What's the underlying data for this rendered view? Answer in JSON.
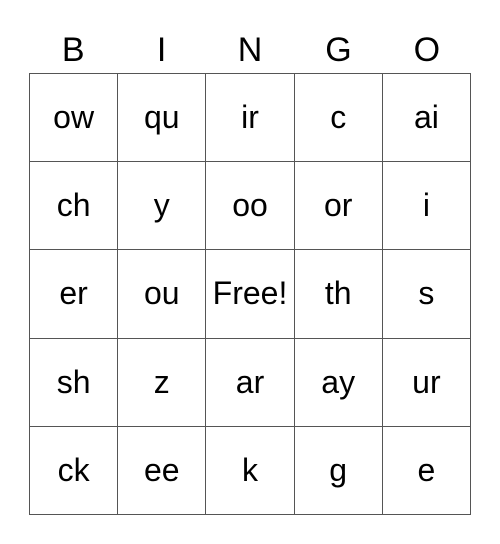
{
  "header": [
    "B",
    "I",
    "N",
    "G",
    "O"
  ],
  "board": [
    [
      "ow",
      "qu",
      "ir",
      "c",
      "ai"
    ],
    [
      "ch",
      "y",
      "oo",
      "or",
      "i"
    ],
    [
      "er",
      "ou",
      "Free!",
      "th",
      "s"
    ],
    [
      "sh",
      "z",
      "ar",
      "ay",
      "ur"
    ],
    [
      "ck",
      "ee",
      "k",
      "g",
      "e"
    ]
  ]
}
